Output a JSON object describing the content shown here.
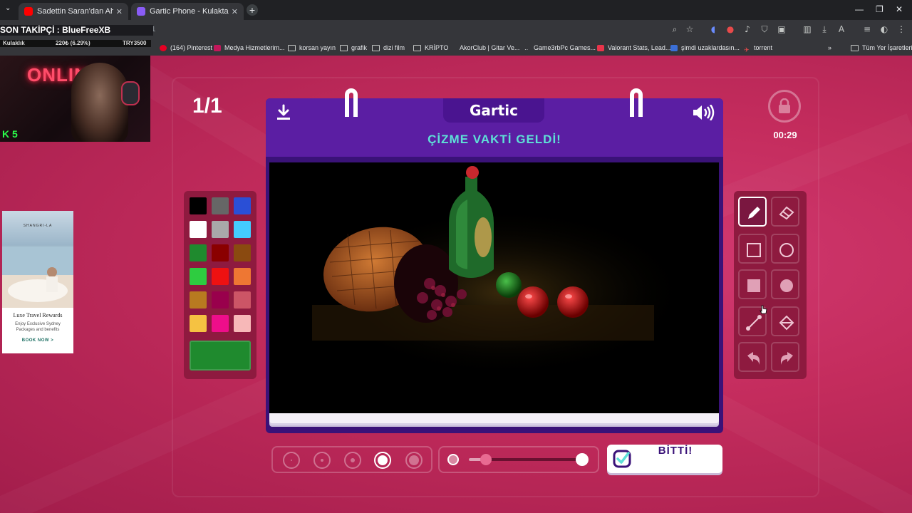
{
  "browser": {
    "tabs": [
      {
        "title": "Sadettin Saran'dan Ahmet Ercan",
        "active": false,
        "favicon_color": "#ff0000"
      },
      {
        "title": "Gartic Phone - Kulaktan Kulağa",
        "active": true,
        "favicon_color": "#8a5cf6"
      }
    ],
    "url": "om/tr/draw?1",
    "bookmarks": [
      "(164) Pinterest",
      "Medya Hizmetlerim...",
      "korsan yayın",
      "grafik",
      "dizi film",
      "KRİPTO",
      "AkorClub | Gitar Ve...",
      "Game3rbPc Games...",
      "Valorant Stats, Lead...",
      "şimdi uzaklardasın...",
      "torrent",
      "Tüm Yer İşaretleri"
    ]
  },
  "overlay": {
    "follower_banner": "SON TAKİPÇİ : BlueFreeXB",
    "ticker_left": "Kulaklık",
    "ticker_mid": "220₺ (6.29%)",
    "ticker_right": "TRY3500",
    "webcam_sign": "ONLIN",
    "webcam_badge": "K 5",
    "ad": {
      "brand": "SHANGRI-LA",
      "title": "Luxe Travel Rewards",
      "subtitle": "Enjoy Exclusive Sydney Packages and benefits",
      "cta": "BOOK NOW >"
    }
  },
  "game": {
    "round": "1/1",
    "logo": "Gartic",
    "prompt": "ÇİZME VAKTİ GELDİ!",
    "timer": "00:29",
    "done_label": "BİTTİ!",
    "selected_color": "#1f8a2e",
    "palette": [
      "#000000",
      "#666666",
      "#2a4fd6",
      "#ffffff",
      "#a9a9a9",
      "#44ccff",
      "#1f8a2e",
      "#8a0000",
      "#8a4a10",
      "#2ecc40",
      "#ee1111",
      "#ee7733",
      "#b87a20",
      "#99004c",
      "#cc5566",
      "#f5c242",
      "#ee0e8a",
      "#f7b8b8"
    ],
    "tools": [
      "pencil-icon",
      "eraser-icon",
      "rectangle-outline-icon",
      "ellipse-outline-icon",
      "rectangle-filled-icon",
      "ellipse-filled-icon",
      "line-icon",
      "fill-bucket-icon",
      "undo-icon",
      "redo-icon"
    ],
    "active_tool": "pencil-icon",
    "brush_sizes": 5,
    "selected_brush_size": 4,
    "opacity_level": 0.15,
    "drawing": "still life: spilled wicker basket with grapes, green bottle, red apples, green apple"
  }
}
